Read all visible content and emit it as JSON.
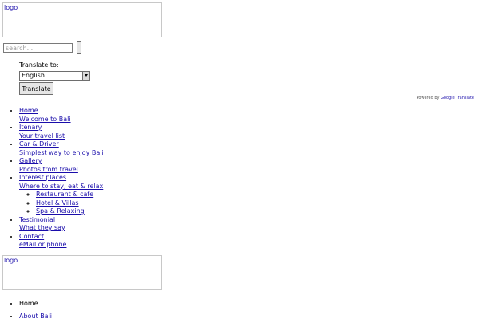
{
  "header": {
    "logo_text": "logo"
  },
  "search": {
    "placeholder": "search..."
  },
  "translate": {
    "label": "Translate to:",
    "selected_language": "English",
    "button_label": "Translate",
    "powered_by": "Powered by",
    "powered_by_link": "Google Translate"
  },
  "nav": {
    "items": [
      {
        "label": " Home",
        "sub": "Welcome to Bali"
      },
      {
        "label": " Itenary",
        "sub": "Your travel list"
      },
      {
        "label": " Car & Driver",
        "sub": "Simplest way to enjoy Bali"
      },
      {
        "label": " Gallery",
        "sub": "Photos from travel"
      },
      {
        "label": " Interest places",
        "sub": "Where to stay, eat & relax",
        "children": [
          " Restaurant & cafe",
          " Hotel & Villas",
          " Spa & Relaxing"
        ]
      },
      {
        "label": " Testimonial",
        "sub": "What they say"
      },
      {
        "label": " Contact",
        "sub": "eMail or phone"
      }
    ]
  },
  "footer": {
    "logo_text": "logo",
    "menu": [
      "Home",
      "About Bali"
    ]
  }
}
